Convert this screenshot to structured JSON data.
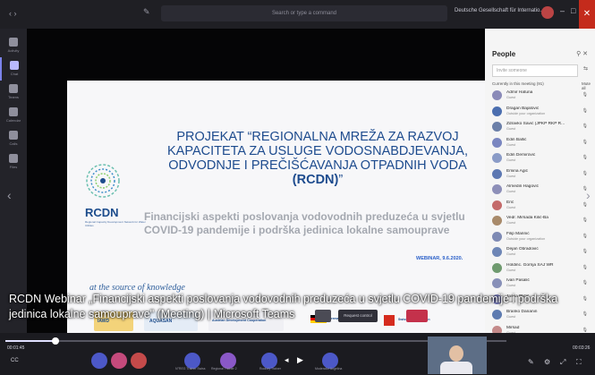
{
  "topbar": {
    "search_placeholder": "Search or type a command",
    "org_label": "Deutsche Gesellschaft für Internatio...",
    "close_glyph": "✕",
    "minimize_glyph": "–",
    "maximize_glyph": "□"
  },
  "rail": {
    "items": [
      {
        "label": "Activity",
        "icon": "bell-icon"
      },
      {
        "label": "Chat",
        "icon": "chat-icon"
      },
      {
        "label": "Teams",
        "icon": "teams-icon"
      },
      {
        "label": "Calendar",
        "icon": "calendar-icon"
      },
      {
        "label": "Calls",
        "icon": "calls-icon"
      },
      {
        "label": "Files",
        "icon": "files-icon"
      }
    ]
  },
  "slide": {
    "logo_text": "RCDN",
    "logo_sub": "Regional Capacity Development Network for Water Utilities",
    "title_pre": "PROJEKAT “REGIONALNA MREŽA ZA RAZVOJ KAPACITETA ZA USLUGE VODOSNABDJEVANJA, ODVODNJE I PREČIŠĆAVANJA OTPADNIH VODA ",
    "title_bold": "(RCDN)",
    "title_post": "”",
    "subtitle": "Financijski aspekti poslovanja vodovodnih preduzeća u svjetlu COVID-19 pandemije i podrška jedinica lokalne samouprave",
    "webinar": "WEBINAR, 9.6.2020.",
    "motto": "at the source of knowledge",
    "partner_logos": [
      "IAWD",
      "AQUASAN",
      "Austrian Development Cooperation",
      "German Cooperation",
      "Swiss Confederation"
    ]
  },
  "caption": {
    "line1": "RCDN Webinar „Financijski aspekti poslovanja vodovodnih preduzeća u svjetlu COVID-19 pandemije i podrška",
    "line2": "jedinica lokalne samouprave\" (Meeting) | Microsoft Teams",
    "request_control": "Request control"
  },
  "bottombar": {
    "elapsed": "00:01:45",
    "remaining": "00:03:26",
    "progress_fraction": 0.1,
    "cc_label": "CC",
    "participant_labels": [
      "N°REG Trainer Swiss",
      "Regional Trainer 2",
      "Rodney Trainer",
      "Moderator Angelina"
    ]
  },
  "people": {
    "title": "People",
    "invite_placeholder": "Invite someone",
    "section_label": "Currently in this meeting (91)",
    "mute_all": "Mute all",
    "participants": [
      {
        "name": "Admir Hatuna",
        "role": "Guest",
        "color": "#8a8ab8"
      },
      {
        "name": "Dragan Bajalović",
        "role": "Outside your organization",
        "color": "#4b6eaf"
      },
      {
        "name": "Zdravko Savić (JPKP RKP R...",
        "role": "Guest",
        "color": "#6b7fa8"
      },
      {
        "name": "Edin Ballić",
        "role": "Guest",
        "color": "#7a86c0"
      },
      {
        "name": "Edin Demirović",
        "role": "Guest",
        "color": "#8a9bc7"
      },
      {
        "name": "Emina Agić",
        "role": "Guest",
        "color": "#5d78b2"
      },
      {
        "name": "Almedin Hagović",
        "role": "Guest",
        "color": "#8d8fb8"
      },
      {
        "name": "Erić",
        "role": "Guest",
        "color": "#c46a6a"
      },
      {
        "name": "Vedr. Mirsada Kilić-Ba",
        "role": "Guest",
        "color": "#a88a6a"
      },
      {
        "name": "Filip Marinić",
        "role": "Outside your organization",
        "color": "#7e8ab4"
      },
      {
        "name": "Dejan Obradović",
        "role": "Guest",
        "color": "#6e86b6"
      },
      {
        "name": "Holdinc. Gornja SAJ WR",
        "role": "Guest",
        "color": "#6f9a6f"
      },
      {
        "name": "Ivan Pasalić",
        "role": "Guest",
        "color": "#8890b8"
      },
      {
        "name": "Jasna Pličić",
        "role": "Guest",
        "color": "#7b7fc0"
      },
      {
        "name": "Branko Dananin",
        "role": "Guest",
        "color": "#5e7bb0"
      },
      {
        "name": "Mirsad",
        "role": "Guest",
        "color": "#c48a8a"
      }
    ]
  }
}
